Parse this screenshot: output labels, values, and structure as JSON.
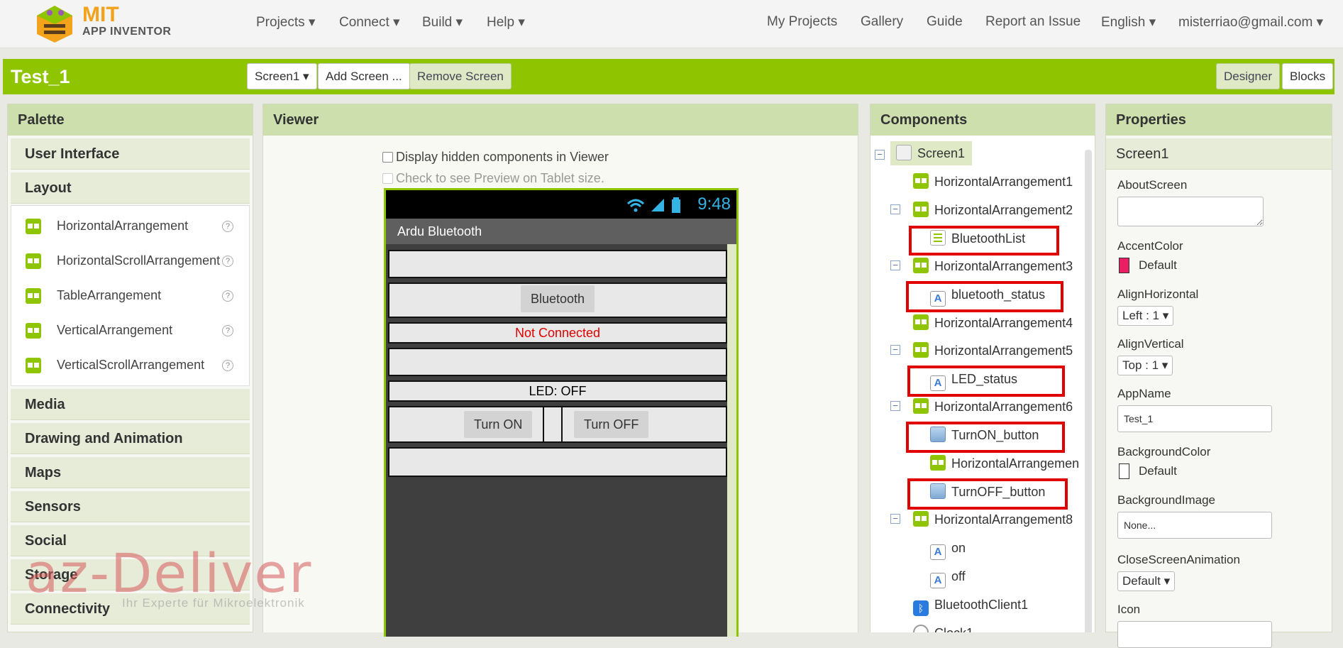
{
  "brand": {
    "mit": "MIT",
    "app": "APP INVENTOR"
  },
  "nav_left": [
    "Projects ▾",
    "Connect ▾",
    "Build ▾",
    "Help ▾"
  ],
  "nav_right": [
    "My Projects",
    "Gallery",
    "Guide",
    "Report an Issue",
    "English ▾",
    "misterriao@gmail.com ▾"
  ],
  "project": {
    "name": "Test_1",
    "screen_select": "Screen1 ▾",
    "add_screen": "Add Screen ...",
    "remove_screen": "Remove Screen",
    "designer": "Designer",
    "blocks": "Blocks"
  },
  "palette": {
    "title": "Palette",
    "categories_top": [
      "User Interface",
      "Layout"
    ],
    "layout_items": [
      "HorizontalArrangement",
      "HorizontalScrollArrangement",
      "TableArrangement",
      "VerticalArrangement",
      "VerticalScrollArrangement"
    ],
    "help_glyph": "?",
    "categories_bottom": [
      "Media",
      "Drawing and Animation",
      "Maps",
      "Sensors",
      "Social",
      "Storage",
      "Connectivity"
    ]
  },
  "viewer": {
    "title": "Viewer",
    "display_hidden": "Display hidden components in Viewer",
    "tablet_preview": "Check to see Preview on Tablet size.",
    "phone": {
      "time": "9:48",
      "app_title": "Ardu Bluetooth",
      "bluetooth_button": "Bluetooth",
      "status_text": "Not Connected",
      "led_text": "LED: OFF",
      "turn_on": "Turn ON",
      "turn_off": "Turn OFF"
    }
  },
  "components": {
    "title": "Components",
    "tree": [
      "Screen1",
      "HorizontalArrangement1",
      "HorizontalArrangement2",
      "BluetoothList",
      "HorizontalArrangement3",
      "bluetooth_status",
      "HorizontalArrangement4",
      "HorizontalArrangement5",
      "LED_status",
      "HorizontalArrangement6",
      "TurnON_button",
      "HorizontalArrangemen",
      "TurnOFF_button",
      "HorizontalArrangement8",
      "on",
      "off",
      "BluetoothClient1",
      "Clock1"
    ]
  },
  "properties": {
    "title": "Properties",
    "component": "Screen1",
    "about_label": "AboutScreen",
    "about_value": "",
    "accent_label": "AccentColor",
    "accent_value": "Default",
    "accent_color": "#e91e63",
    "align_h_label": "AlignHorizontal",
    "align_h_value": "Left : 1 ▾",
    "align_v_label": "AlignVertical",
    "align_v_value": "Top : 1 ▾",
    "appname_label": "AppName",
    "appname_value": "Test_1",
    "bg_color_label": "BackgroundColor",
    "bg_color_value": "Default",
    "bg_image_label": "BackgroundImage",
    "bg_image_value": "None...",
    "close_anim_label": "CloseScreenAnimation",
    "close_anim_value": "Default ▾",
    "icon_label": "Icon"
  },
  "watermark": {
    "logo": "az-Deliver",
    "tagline": "Ihr Experte für Mikroelektronik"
  },
  "colors": {
    "brand_green": "#8fc400",
    "panel_header": "#cddfad",
    "highlight_red": "#e00000",
    "status_red": "#e00000"
  }
}
